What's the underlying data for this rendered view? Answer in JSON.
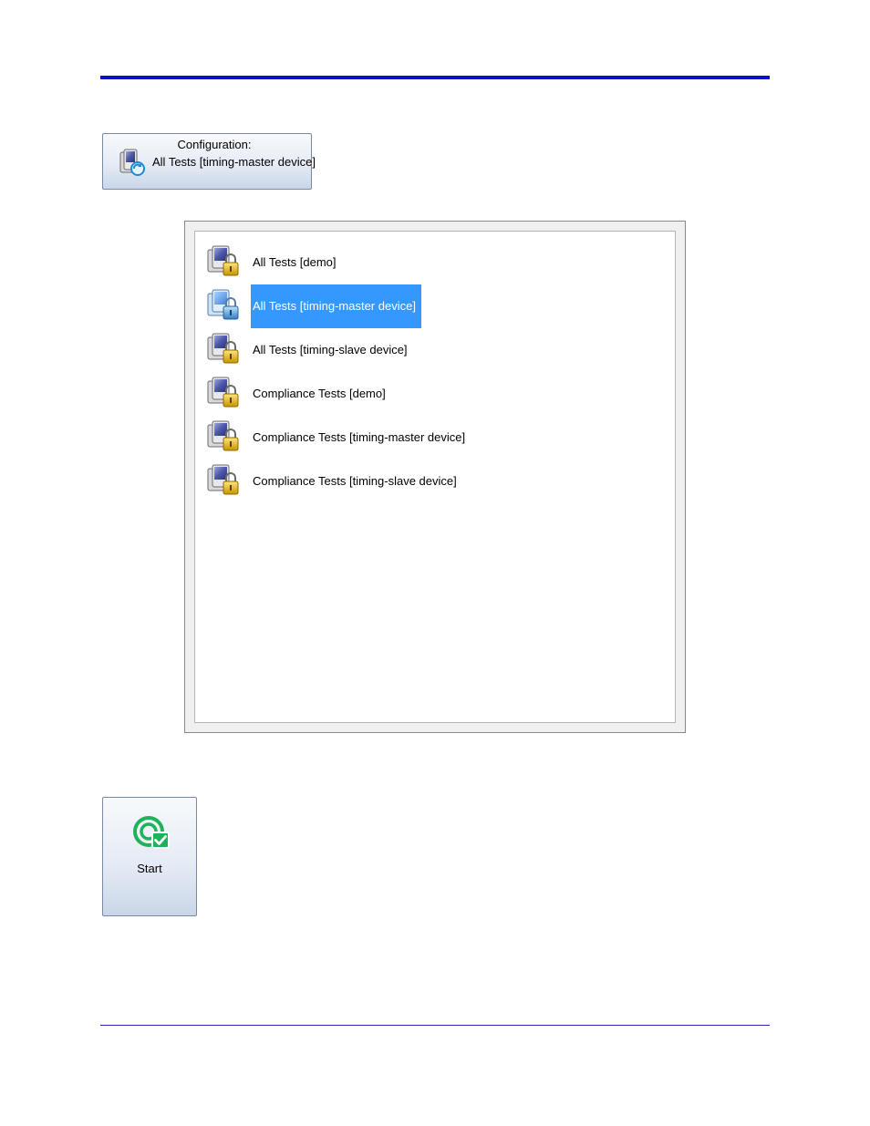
{
  "config_button": {
    "heading": "Configuration:",
    "value": "All Tests [timing-master device]",
    "icon": "config-refresh-icon"
  },
  "config_list": {
    "items": [
      {
        "label": "All Tests [demo]",
        "icon": "locked-config-icon",
        "selected": false
      },
      {
        "label": "All Tests [timing-master device]",
        "icon": "locked-config-icon",
        "selected": true
      },
      {
        "label": "All Tests [timing-slave device]",
        "icon": "locked-config-icon",
        "selected": false
      },
      {
        "label": "Compliance Tests [demo]",
        "icon": "locked-config-icon",
        "selected": false
      },
      {
        "label": "Compliance Tests [timing-master device]",
        "icon": "locked-config-icon",
        "selected": false
      },
      {
        "label": "Compliance Tests [timing-slave device]",
        "icon": "locked-config-icon",
        "selected": false
      }
    ],
    "selection_color": "#3399ff"
  },
  "start_button": {
    "label": "Start",
    "icon": "start-check-icon",
    "accent": "#1fb25a"
  },
  "colors": {
    "top_rule": "#0a10c8",
    "bottom_rule": "#2a2ab0"
  }
}
